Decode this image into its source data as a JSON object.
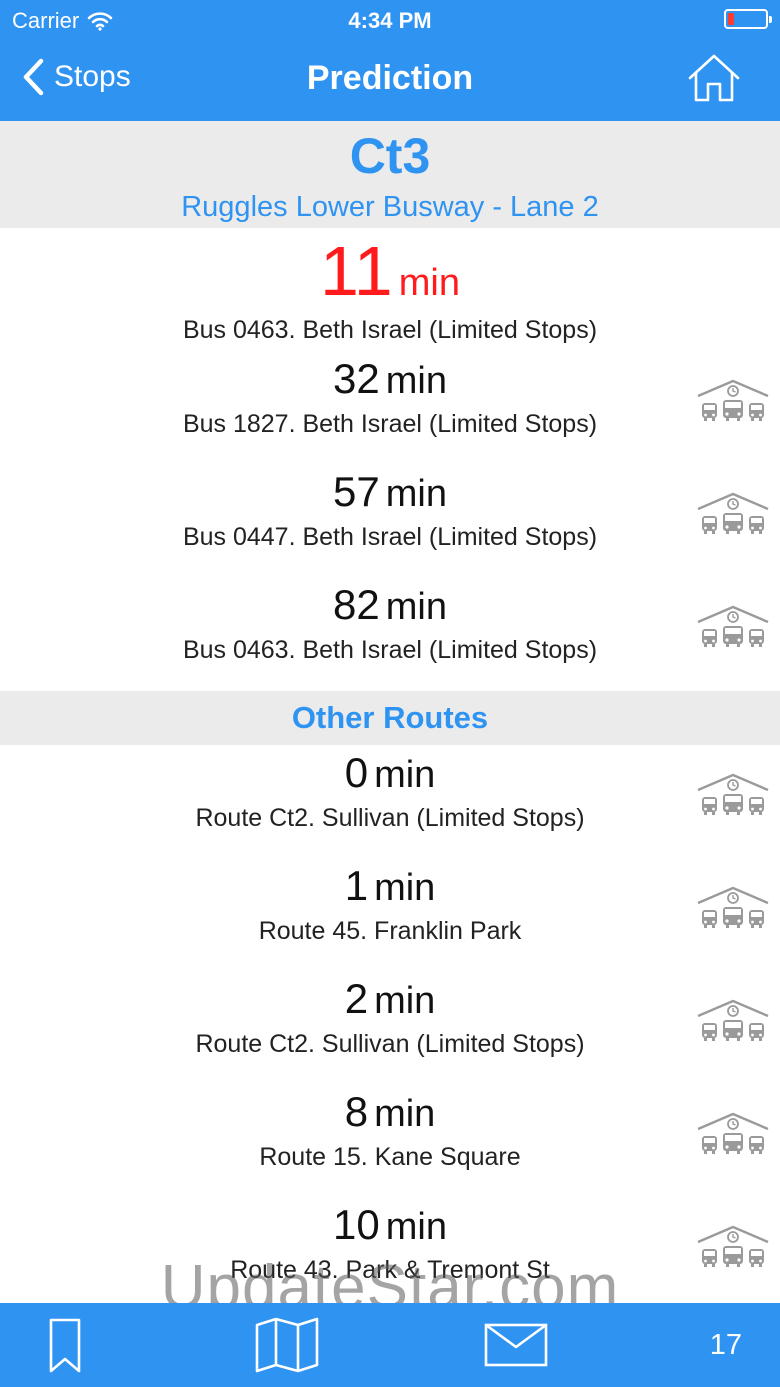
{
  "status_bar": {
    "carrier": "Carrier",
    "time": "4:34 PM"
  },
  "nav": {
    "back_label": "Stops",
    "title": "Prediction"
  },
  "header": {
    "route": "Ct3",
    "stop": "Ruggles Lower Busway - Lane 2"
  },
  "predictions": [
    {
      "minutes": "11",
      "unit": "min",
      "desc": "Bus 0463. Beth Israel (Limited Stops)"
    },
    {
      "minutes": "32",
      "unit": "min",
      "desc": "Bus 1827. Beth Israel (Limited Stops)"
    },
    {
      "minutes": "57",
      "unit": "min",
      "desc": "Bus 0447. Beth Israel (Limited Stops)"
    },
    {
      "minutes": "82",
      "unit": "min",
      "desc": "Bus 0463. Beth Israel (Limited Stops)"
    }
  ],
  "other_routes": {
    "title": "Other Routes",
    "items": [
      {
        "minutes": "0",
        "unit": "min",
        "desc": "Route Ct2. Sullivan (Limited Stops)"
      },
      {
        "minutes": "1",
        "unit": "min",
        "desc": "Route 45. Franklin Park"
      },
      {
        "minutes": "2",
        "unit": "min",
        "desc": "Route Ct2. Sullivan (Limited Stops)"
      },
      {
        "minutes": "8",
        "unit": "min",
        "desc": "Route 15. Kane Square"
      },
      {
        "minutes": "10",
        "unit": "min",
        "desc": "Route 43. Park & Tremont St"
      }
    ]
  },
  "tabbar": {
    "count": "17"
  },
  "watermark": "UpdateStar.com",
  "colors": {
    "accent": "#2f93f2",
    "alert": "#ff1b1b",
    "band": "#ebebeb"
  }
}
